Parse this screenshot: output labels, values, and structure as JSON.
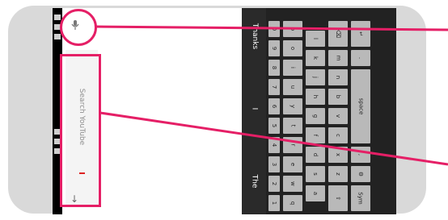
{
  "search": {
    "placeholder": "Search YouTube",
    "cursor_color": "#dd2222"
  },
  "suggestions": [
    "The",
    "I",
    "Thanks"
  ],
  "keyboard": {
    "row_numbers": [
      "1",
      "2",
      "3",
      "4",
      "5",
      "6",
      "7",
      "8",
      "9",
      "0"
    ],
    "row_top": [
      "q",
      "w",
      "e",
      "r",
      "t",
      "y",
      "u",
      "i",
      "o",
      "p"
    ],
    "row_mid": [
      "a",
      "s",
      "d",
      "f",
      "g",
      "h",
      "j",
      "k",
      "l"
    ],
    "row_bottom": [
      "⇧",
      "z",
      "x",
      "c",
      "v",
      "b",
      "n",
      "m",
      "⌫"
    ],
    "space_row": [
      "Sym",
      "⚙",
      ",",
      "space",
      ".",
      "↵"
    ]
  },
  "icons": {
    "mic": "mic-icon",
    "back": "back-arrow-icon"
  },
  "colors": {
    "callout": "#e51f66",
    "device_frame": "#d9d9d9",
    "keyboard_bg": "#222222"
  }
}
